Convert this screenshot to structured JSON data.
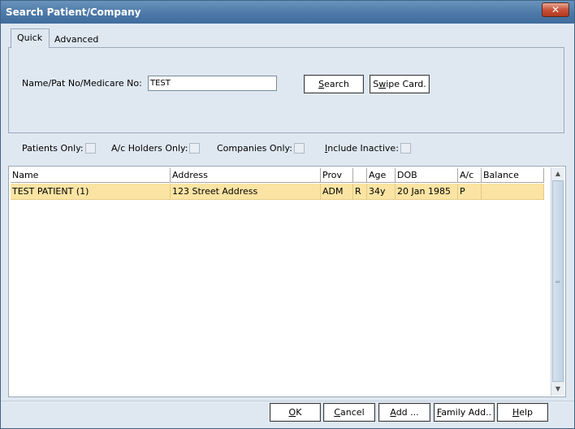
{
  "window": {
    "title": "Search Patient/Company",
    "close_glyph": "✕"
  },
  "tabs": [
    {
      "label": "Quick",
      "active": true
    },
    {
      "label": "Advanced",
      "active": false
    }
  ],
  "search": {
    "label": "Name/Pat No/Medicare No:",
    "value": "TEST",
    "search_button": {
      "pre": "",
      "u": "S",
      "post": "earch"
    },
    "swipe_button": {
      "pre": "S",
      "u": "w",
      "post": "ipe Card."
    }
  },
  "filters": [
    {
      "label": "Patients Only:",
      "checked": false
    },
    {
      "label": "A/c Holders Only:",
      "checked": false
    },
    {
      "label": "Companies Only:",
      "checked": false
    },
    {
      "label_u": "I",
      "label_rest": "nclude Inactive:",
      "checked": false
    }
  ],
  "grid": {
    "columns": [
      "Name",
      "Address",
      "Prov",
      "",
      "Age",
      "DOB",
      "A/c",
      "Balance"
    ],
    "rows": [
      [
        "TEST PATIENT  (1)",
        "123 Street Address",
        "ADM",
        "R",
        "34y",
        "20 Jan 1985",
        "P",
        ""
      ]
    ]
  },
  "buttons": {
    "ok": {
      "u": "O",
      "rest": "K"
    },
    "cancel": {
      "u": "C",
      "rest": "ancel"
    },
    "add": {
      "u": "A",
      "rest": "dd ..."
    },
    "family_add": {
      "u": "F",
      "rest": "amily Add.."
    },
    "help": {
      "u": "H",
      "rest": "elp"
    }
  },
  "colors": {
    "titlebar": "#4d79a8",
    "selected_row": "#fbe4a3",
    "window_bg": "#dfe8f1"
  }
}
